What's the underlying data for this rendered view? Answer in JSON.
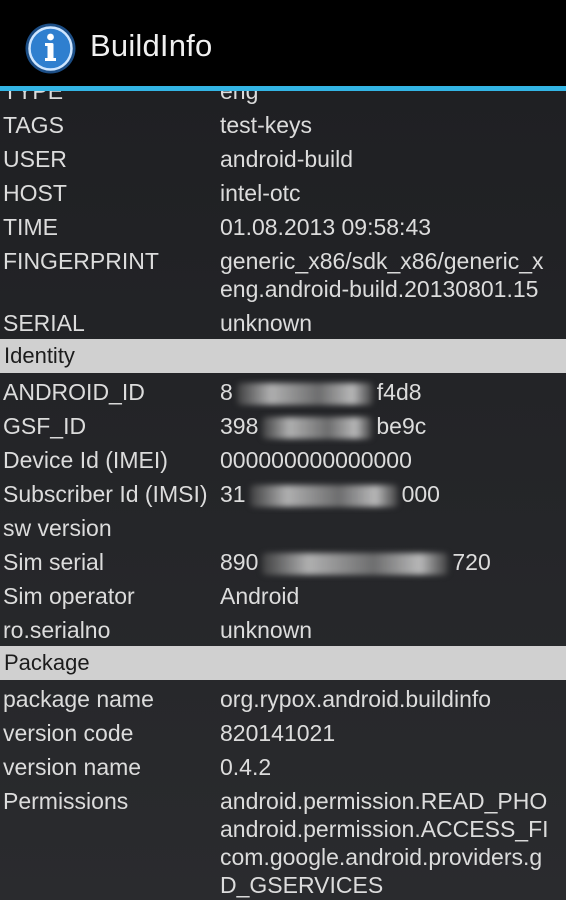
{
  "action_bar": {
    "title": "BuildInfo",
    "icon": "info-circle-icon"
  },
  "build_rows": [
    {
      "label": "TYPE",
      "value": "eng"
    },
    {
      "label": "TAGS",
      "value": "test-keys"
    },
    {
      "label": "USER",
      "value": "android-build"
    },
    {
      "label": "HOST",
      "value": "intel-otc"
    },
    {
      "label": "TIME",
      "value": "01.08.2013 09:58:43"
    },
    {
      "label": "FINGERPRINT",
      "value_line1": "generic_x86/sdk_x86/generic_x",
      "value_line2": "eng.android-build.20130801.15"
    },
    {
      "label": "SERIAL",
      "value": "unknown"
    }
  ],
  "identity": {
    "header": "Identity",
    "rows": [
      {
        "label": "ANDROID_ID",
        "value_prefix": "8",
        "value_suffix": "f4d8"
      },
      {
        "label": "GSF_ID",
        "value_prefix": "398",
        "value_suffix": "be9c"
      },
      {
        "label": "Device Id (IMEI)",
        "value": "000000000000000"
      },
      {
        "label": "Subscriber Id (IMSI)",
        "value_prefix": "31",
        "value_suffix": "000"
      },
      {
        "label": "sw version",
        "value": ""
      },
      {
        "label": "Sim serial",
        "value_prefix": "890",
        "value_suffix": "720"
      },
      {
        "label": "Sim operator",
        "value": "Android"
      },
      {
        "label": "ro.serialno",
        "value": "unknown"
      }
    ]
  },
  "package": {
    "header": "Package",
    "rows": [
      {
        "label": "package name",
        "value": "org.rypox.android.buildinfo"
      },
      {
        "label": "version code",
        "value": "820141021"
      },
      {
        "label": "version name",
        "value": "0.4.2"
      },
      {
        "label": "Permissions",
        "lines": [
          "android.permission.READ_PHO",
          "android.permission.ACCESS_FI",
          "com.google.android.providers.g",
          "D_GSERVICES"
        ]
      }
    ]
  }
}
